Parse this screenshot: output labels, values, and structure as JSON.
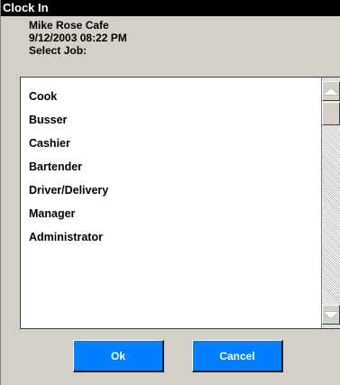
{
  "window": {
    "title": "Clock In"
  },
  "info": {
    "restaurant": "Mike Rose Cafe",
    "datetime": "9/12/2003 08:22 PM",
    "prompt": "Select Job:"
  },
  "jobs": [
    {
      "label": "Cook"
    },
    {
      "label": "Busser"
    },
    {
      "label": "Cashier"
    },
    {
      "label": "Bartender"
    },
    {
      "label": "Driver/Delivery"
    },
    {
      "label": "Manager"
    },
    {
      "label": "Administrator"
    }
  ],
  "scrollbar": {
    "up_icon": "arrow-up-icon",
    "down_icon": "arrow-down-icon"
  },
  "buttons": {
    "ok": "Ok",
    "cancel": "Cancel"
  },
  "colors": {
    "titlebar": "#000000",
    "dialog_bg": "#d4d0c8",
    "button": "#0080ff",
    "button_text": "#ffffff"
  }
}
